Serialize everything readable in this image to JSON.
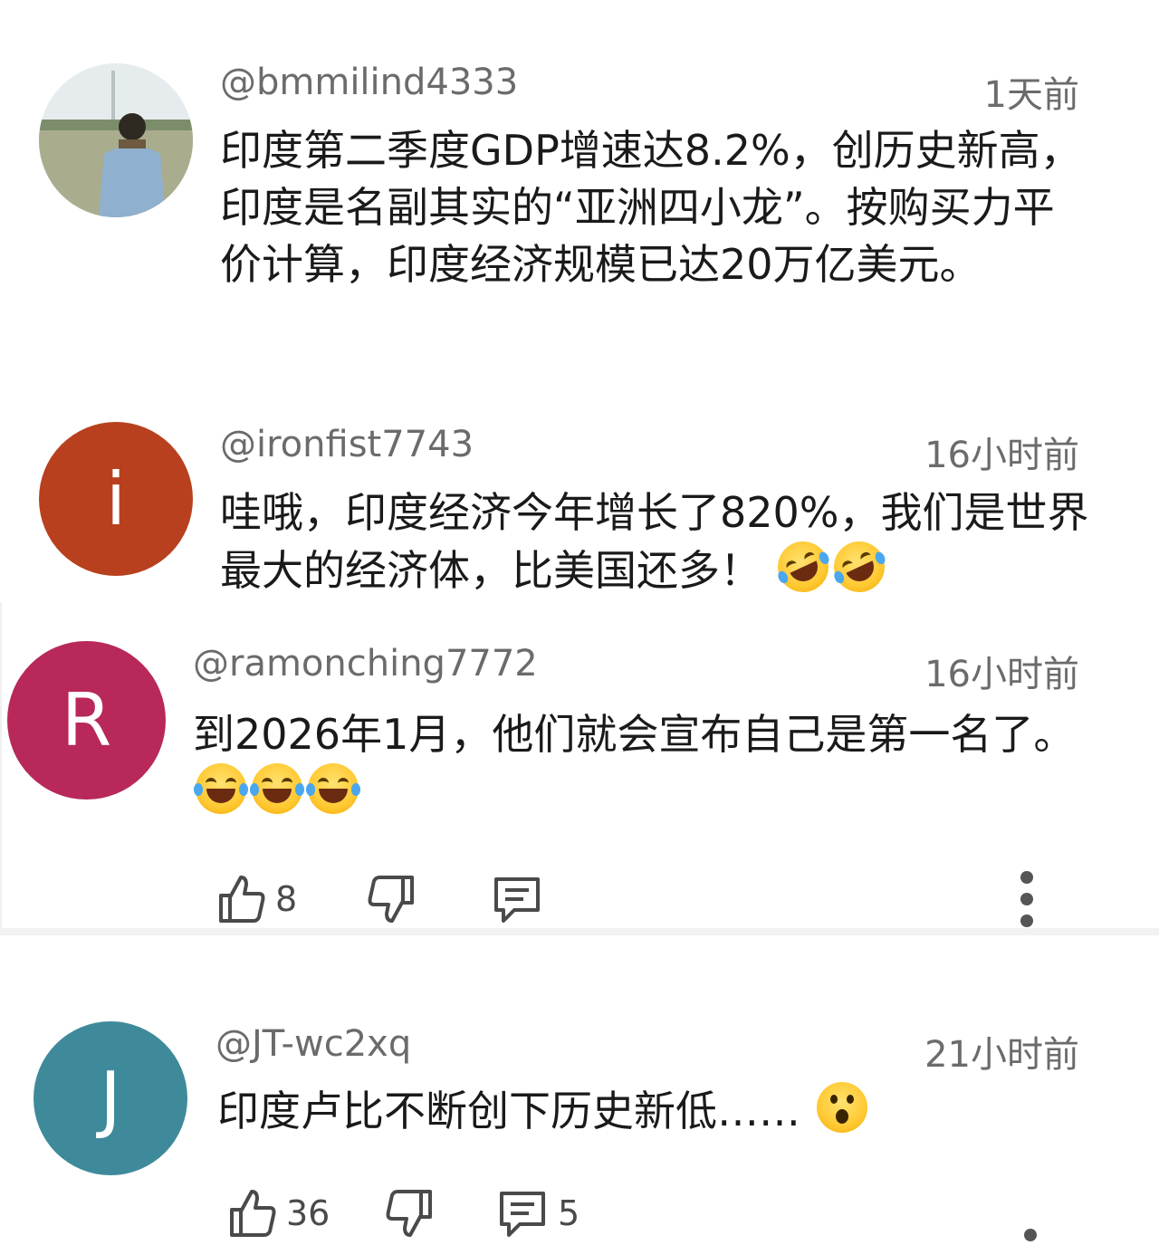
{
  "comments": [
    {
      "username": "@bmmilind4333",
      "time": "1天前",
      "avatar_letter": "",
      "avatar_color": "#cfd8cf",
      "text": "印度第二季度GDP增速达8.2%，创历史新高，印度是名副其实的“亚洲四小龙”。按购买力平价计算，印度经济规模已达20万亿美元。"
    },
    {
      "username": "@ironfist7743",
      "time": "16小时前",
      "avatar_letter": "i",
      "avatar_color": "#b8401e",
      "text": "哇哦，印度经济今年增长了820%，我们是世界最大的经济体，比美国还多！",
      "emojis": [
        "rofl-emoji",
        "rofl-emoji"
      ]
    },
    {
      "username": "@ramonching7772",
      "time": "16小时前",
      "avatar_letter": "R",
      "avatar_color": "#b8285a",
      "text": "到2026年1月，他们就会宣布自己是第一名了。",
      "emojis": [
        "tears-of-joy-emoji",
        "tears-of-joy-emoji",
        "tears-of-joy-emoji"
      ],
      "likes": "8"
    },
    {
      "username": "@JT-wc2xq",
      "time": "21小时前",
      "avatar_letter": "J",
      "avatar_color": "#3e8a9b",
      "text": "印度卢比不断创下历史新低……",
      "emojis": [
        "surprised-emoji"
      ],
      "likes": "36",
      "replies": "5"
    }
  ],
  "icons": {
    "like": "thumbs-up-icon",
    "dislike": "thumbs-down-icon",
    "reply": "comment-icon",
    "more": "more-vertical-icon"
  }
}
